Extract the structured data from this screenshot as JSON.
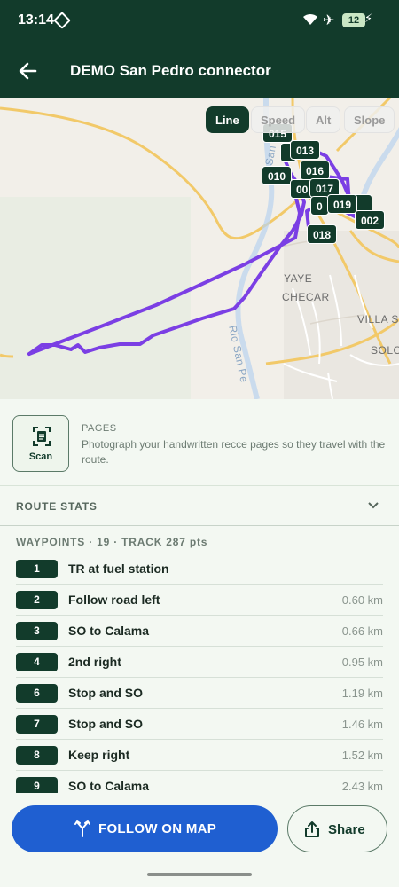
{
  "status_bar": {
    "time": "13:14",
    "battery": "12"
  },
  "app_bar": {
    "title": "DEMO San Pedro connector",
    "back_icon": "arrow-left-icon"
  },
  "map": {
    "view_chips": [
      {
        "label": "Line",
        "active": true
      },
      {
        "label": "Speed",
        "active": false
      },
      {
        "label": "Alt",
        "active": false
      },
      {
        "label": "Slope",
        "active": false
      }
    ],
    "place_labels": [
      "YAYE",
      "CHECAR",
      "VILLA S",
      "SOLO",
      "Rio San Pe",
      "Rio San Pe"
    ],
    "waypoint_markers": [
      "015",
      "013",
      "016",
      "010",
      "00",
      "017",
      "019",
      "0",
      "002",
      "018"
    ],
    "route_color": "#7b3fe4"
  },
  "pages": {
    "scan_label": "Scan",
    "heading": "PAGES",
    "description": "Photograph your handwritten recce pages so they travel with the route."
  },
  "route_stats": {
    "label": "ROUTE STATS"
  },
  "waypoints": {
    "header": "WAYPOINTS · 19  ·  TRACK 287 pts",
    "items": [
      {
        "num": "1",
        "text": "TR at fuel station",
        "dist": ""
      },
      {
        "num": "2",
        "text": "Follow road left",
        "dist": "0.60 km"
      },
      {
        "num": "3",
        "text": "SO to Calama",
        "dist": "0.66 km"
      },
      {
        "num": "4",
        "text": "2nd right",
        "dist": "0.95 km"
      },
      {
        "num": "6",
        "text": "Stop and SO",
        "dist": "1.19 km"
      },
      {
        "num": "7",
        "text": "Stop and SO",
        "dist": "1.46 km"
      },
      {
        "num": "8",
        "text": "Keep right",
        "dist": "1.52 km"
      },
      {
        "num": "9",
        "text": "SO to Calama",
        "dist": "2.43 km"
      }
    ]
  },
  "actions": {
    "follow_label": "FOLLOW ON MAP",
    "share_label": "Share"
  },
  "colors": {
    "brand_dark": "#123b2b",
    "primary_blue": "#1f5fd1"
  }
}
